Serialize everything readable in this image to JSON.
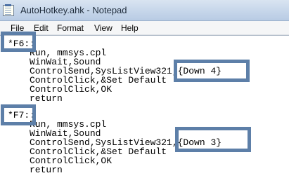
{
  "window": {
    "title": "AutoHotkey.ahk - Notepad",
    "app_icon": "notepad-icon"
  },
  "menu": [
    "File",
    "Edit",
    "Format",
    "View",
    "Help"
  ],
  "code": {
    "block1": {
      "hotkey": "*F6::",
      "lines": [
        "Run, mmsys.cpl",
        "WinWait,Sound",
        "ControlSend,SysListView321,{Down 4}",
        "ControlClick,&Set Default",
        "ControlClick,OK",
        "return"
      ]
    },
    "block2": {
      "hotkey": "*F7::",
      "lines": [
        "Run, mmsys.cpl",
        "WinWait,Sound",
        "ControlSend,SysListView321,{Down 3}",
        "ControlClick,&Set Default",
        "ControlClick,OK",
        "return"
      ]
    }
  },
  "highlight_color": "#5d7fa8"
}
